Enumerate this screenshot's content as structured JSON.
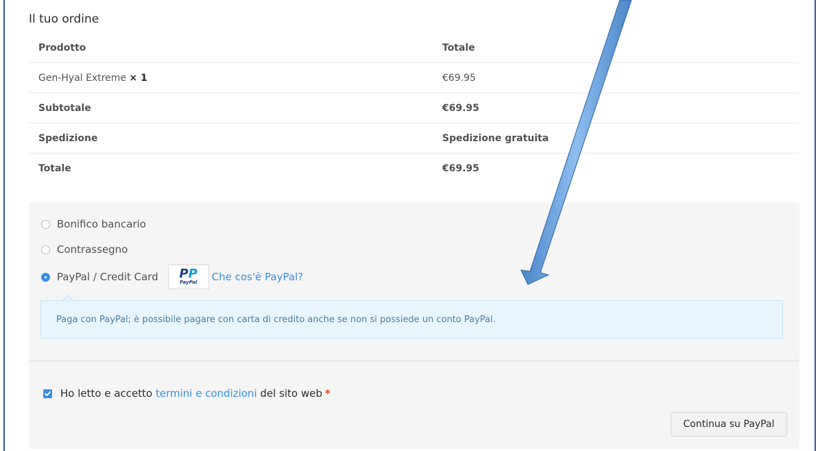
{
  "order": {
    "title": "Il tuo ordine",
    "headers": {
      "product": "Prodotto",
      "total": "Totale"
    },
    "item": {
      "name": "Gen-Hyal Extreme",
      "qty": "× 1",
      "price": "€69.95"
    },
    "subtotal": {
      "label": "Subtotale",
      "value": "€69.95"
    },
    "shipping": {
      "label": "Spedizione",
      "value": "Spedizione gratuita"
    },
    "total": {
      "label": "Totale",
      "value": "€69.95"
    }
  },
  "payment": {
    "methods": [
      {
        "label": "Bonifico bancario",
        "selected": false
      },
      {
        "label": "Contrassegno",
        "selected": false
      },
      {
        "label": "PayPal / Credit Card",
        "selected": true
      }
    ],
    "paypal_logo_text": "PayPal",
    "paypal_link": "Che cos'è PayPal?",
    "paypal_notice": "Paga con PayPal; è possibile pagare con carta di credito anche se non si possiede un conto PayPal."
  },
  "terms": {
    "prefix": "Ho letto e accetto",
    "link": "termini e condizioni",
    "suffix": "del sito web",
    "required_mark": "*",
    "checked": true
  },
  "button": {
    "label": "Continua su PayPal"
  },
  "colors": {
    "accent": "#3a8ee0",
    "frame": "#2f5496",
    "arrow": "#5b9bd5"
  }
}
